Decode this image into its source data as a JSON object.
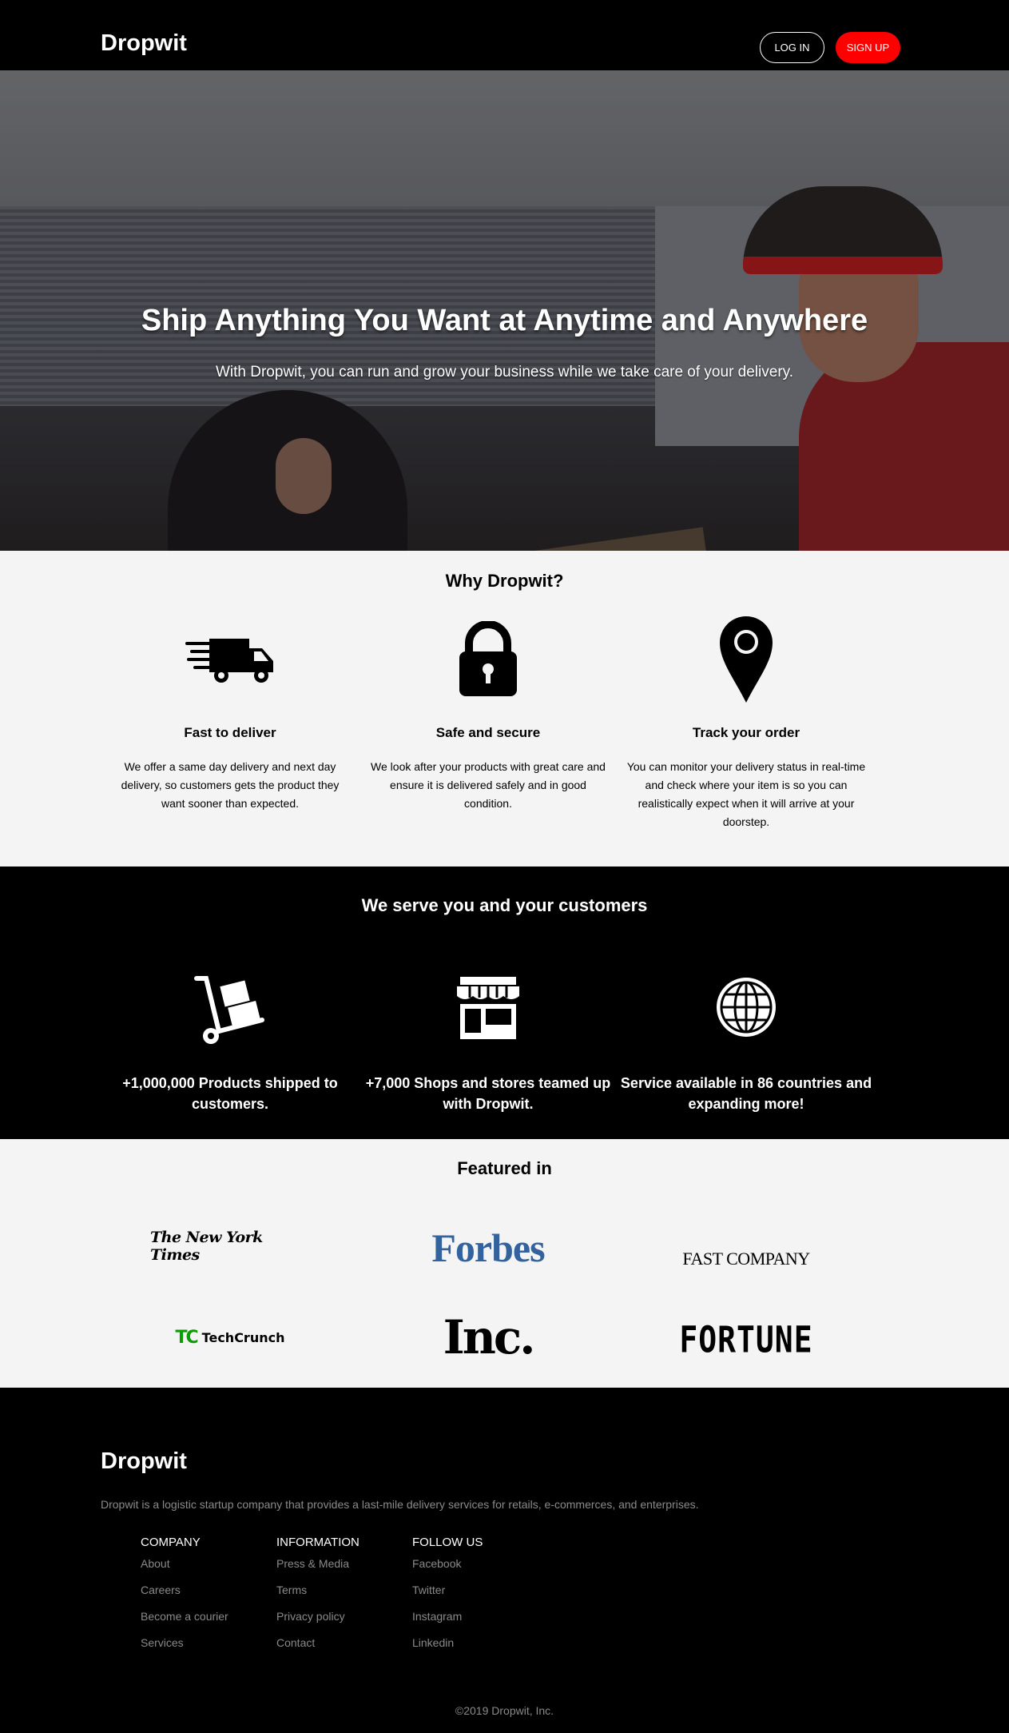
{
  "nav": {
    "brand": "Dropwit",
    "login_label": "LOG IN",
    "signup_label": "SIGN UP"
  },
  "hero": {
    "title": "Ship Anything You Want at Anytime and Anywhere",
    "subtitle": "With Dropwit, you can run and grow your business while we take care of your delivery."
  },
  "why": {
    "heading": "Why Dropwit?",
    "features": [
      {
        "icon": "delivery-truck-icon",
        "title": "Fast to deliver",
        "text": "We offer a same day delivery and next day delivery, so customers gets the product they want sooner than expected."
      },
      {
        "icon": "padlock-icon",
        "title": "Safe and secure",
        "text": "We look after your products with great care and ensure it is delivered safely and in good condition."
      },
      {
        "icon": "map-pin-icon",
        "title": "Track your order",
        "text": "You can monitor your delivery status in real-time and check where your item is so you can realistically expect when it will arrive at your doorstep."
      }
    ]
  },
  "serve": {
    "heading": "We serve you and your customers",
    "stats": [
      {
        "icon": "hand-truck-icon",
        "text": "+1,000,000 Products shipped to customers."
      },
      {
        "icon": "storefront-icon",
        "text": "+7,000 Shops and stores teamed up with Dropwit."
      },
      {
        "icon": "globe-icon",
        "text": "Service available in 86 countries and expanding more!"
      }
    ]
  },
  "featured": {
    "heading": "Featured in",
    "logos": {
      "nyt": "The New York Times",
      "forbes": "Forbes",
      "fastco": "FAST COMPANY",
      "tc_mark": "TC",
      "tc_word": "TechCrunch",
      "inc": "Inc.",
      "fortune": "FORTUNE"
    }
  },
  "footer": {
    "brand": "Dropwit",
    "description": "Dropwit is a logistic startup company that provides a last-mile delivery services for retails, e-commerces, and enterprises.",
    "columns": [
      {
        "heading": "COMPANY",
        "links": [
          "About",
          "Careers",
          "Become a courier",
          "Services"
        ]
      },
      {
        "heading": "INFORMATION",
        "links": [
          "Press & Media",
          "Terms",
          "Privacy policy",
          "Contact"
        ]
      },
      {
        "heading": "FOLLOW US",
        "links": [
          "Facebook",
          "Twitter",
          "Instagram",
          "Linkedin"
        ]
      }
    ],
    "copyright": "©2019 Dropwit, Inc."
  },
  "colors": {
    "accent": "#ff0000",
    "background_dark": "#000000",
    "background_light": "#f4f4f4",
    "muted_text": "#8a8a8a"
  }
}
